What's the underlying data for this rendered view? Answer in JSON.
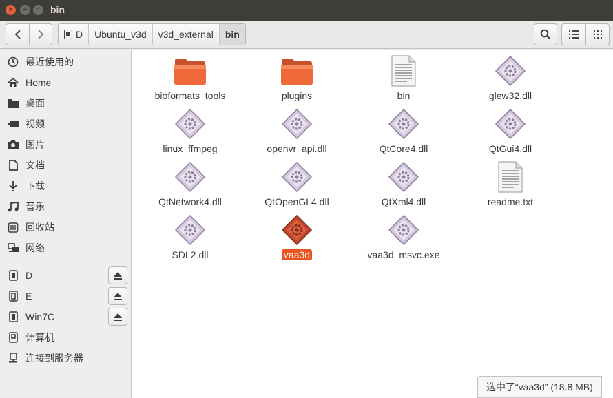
{
  "window": {
    "title": "bin"
  },
  "toolbar": {
    "breadcrumbs": [
      "D",
      "Ubuntu_v3d",
      "v3d_external",
      "bin"
    ]
  },
  "sidebar": {
    "places": [
      {
        "label": "最近使用的",
        "icon": "clock-icon"
      },
      {
        "label": "Home",
        "icon": "home-icon"
      },
      {
        "label": "桌面",
        "icon": "folder-icon"
      },
      {
        "label": "视频",
        "icon": "video-icon"
      },
      {
        "label": "图片",
        "icon": "camera-icon"
      },
      {
        "label": "文档",
        "icon": "document-icon"
      },
      {
        "label": "下载",
        "icon": "download-icon"
      },
      {
        "label": "音乐",
        "icon": "music-icon"
      },
      {
        "label": "回收站",
        "icon": "trash-icon"
      },
      {
        "label": "网络",
        "icon": "network-icon"
      }
    ],
    "devices": [
      {
        "label": "D",
        "icon": "drive-icon",
        "eject": true
      },
      {
        "label": "E",
        "icon": "drive-icon",
        "eject": true
      },
      {
        "label": "Win7C",
        "icon": "drive-icon",
        "eject": true
      },
      {
        "label": "计算机",
        "icon": "computer-icon",
        "eject": false
      },
      {
        "label": "连接到服务器",
        "icon": "server-icon",
        "eject": false
      }
    ]
  },
  "files": [
    {
      "name": "bioformats_tools",
      "type": "folder"
    },
    {
      "name": "plugins",
      "type": "folder"
    },
    {
      "name": "bin",
      "type": "document"
    },
    {
      "name": "glew32.dll",
      "type": "library"
    },
    {
      "name": "linux_ffmpeg",
      "type": "library"
    },
    {
      "name": "openvr_api.dll",
      "type": "library"
    },
    {
      "name": "QtCore4.dll",
      "type": "library"
    },
    {
      "name": "QtGui4.dll",
      "type": "library"
    },
    {
      "name": "QtNetwork4.dll",
      "type": "library"
    },
    {
      "name": "QtOpenGL4.dll",
      "type": "library"
    },
    {
      "name": "QtXml4.dll",
      "type": "library"
    },
    {
      "name": "readme.txt",
      "type": "document"
    },
    {
      "name": "SDL2.dll",
      "type": "library"
    },
    {
      "name": "vaa3d",
      "type": "library",
      "selected": true
    },
    {
      "name": "vaa3d_msvc.exe",
      "type": "library"
    }
  ],
  "status": {
    "text": "选中了“vaa3d” (18.8 MB)"
  },
  "colors": {
    "accent": "#e95420",
    "titlebar": "#3e3d39",
    "folder": "#f0693a"
  }
}
